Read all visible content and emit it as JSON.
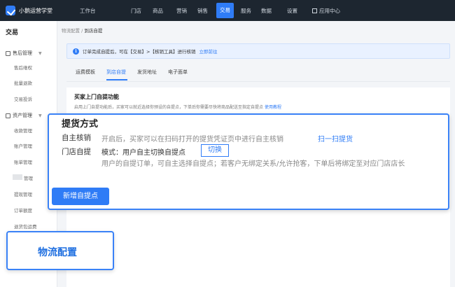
{
  "header": {
    "brand": "小鹅运营学堂",
    "workbench": "工作台",
    "nav": [
      {
        "label": "门店",
        "active": false
      },
      {
        "label": "商品",
        "active": false
      },
      {
        "label": "营销",
        "active": false
      },
      {
        "label": "销售",
        "active": false
      },
      {
        "label": "交易",
        "active": true
      },
      {
        "label": "服务",
        "active": false
      },
      {
        "label": "数据",
        "active": false
      },
      {
        "label": "设置",
        "active": false
      }
    ],
    "app_center": "应用中心",
    "accent": "#2f7cf6",
    "bg": "#1d2630"
  },
  "sidebar": {
    "title": "交易",
    "section1": "售后管理",
    "section1_items": [
      "售后维权",
      "批量退款",
      "交易投诉"
    ],
    "section2": "资产管理",
    "section2_items": [
      "收款管理",
      "账户管理",
      "账单管理",
      "管理",
      "提现管理",
      "订单额度",
      "退货包运费"
    ]
  },
  "breadcrumb": {
    "parent": "物流配置",
    "sep": "/",
    "current": "到店自提"
  },
  "notice": {
    "text": "订单完成自提后，可在【交易】>【核销工具】进行核销",
    "link": "立即前往",
    "icon": "info-icon"
  },
  "tabs": [
    {
      "label": "运费模板",
      "active": false
    },
    {
      "label": "到店自提",
      "active": true
    },
    {
      "label": "发货地址",
      "active": false
    },
    {
      "label": "电子面单",
      "active": false
    }
  ],
  "card": {
    "title": "买家上门自提功能",
    "desc": "启用上门自提功能后，买家可以就近选择你预设的自提点，下单后你需要尽快将商品配送至指定自提点",
    "desc_link": "使用教程"
  },
  "callout": {
    "heading": "提货方式",
    "row1_label": "自主核销",
    "row1_text": "开启后，买家可以在扫码打开的提货凭证页中进行自主核销",
    "row1_link": "扫一扫提货",
    "row2_label": "门店自提",
    "row2_mode": "模式：用户自主切换自提点",
    "row2_switch": "切换",
    "row2_desc": "用户的自提订单，可自主选择自提点；若客户无绑定关系/允许抢客，下单后将绑定至对应门店店长",
    "add_button": "新增自提点"
  },
  "overlay_label": "物流配置"
}
